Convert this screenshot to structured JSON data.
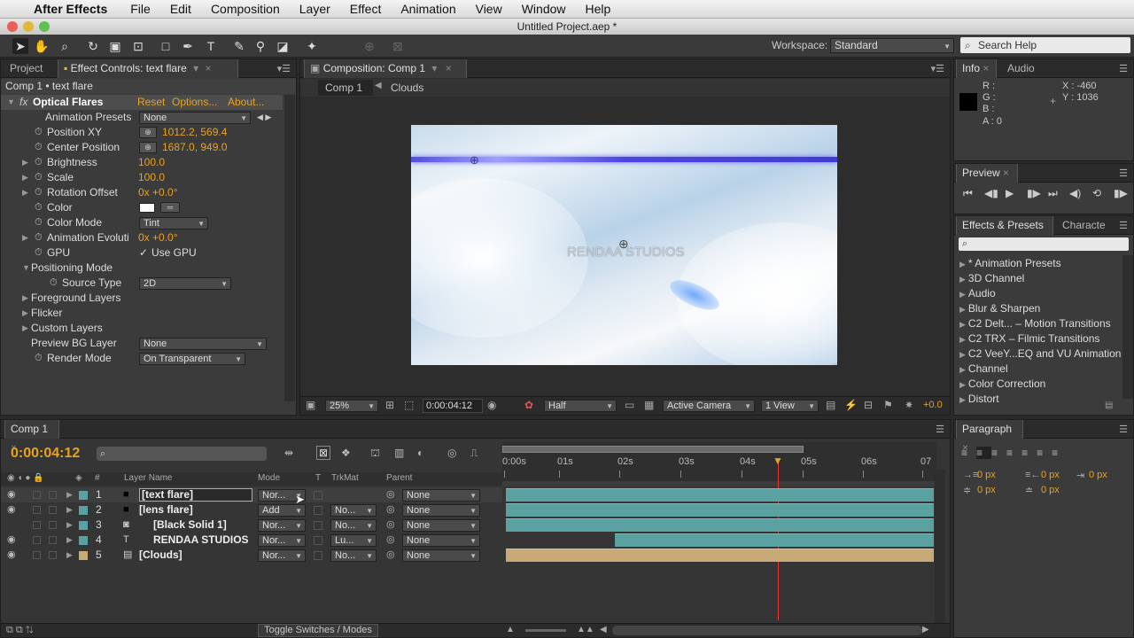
{
  "menubar": {
    "app": "After Effects",
    "items": [
      "File",
      "Edit",
      "Composition",
      "Layer",
      "Effect",
      "Animation",
      "View",
      "Window",
      "Help"
    ]
  },
  "window": {
    "title": "Untitled Project.aep *"
  },
  "toolbar": {
    "workspace_label": "Workspace:",
    "workspace_value": "Standard",
    "search_placeholder": "Search Help"
  },
  "left_panel": {
    "tab_project": "Project",
    "tab_effect": "Effect Controls: text flare",
    "breadcrumb": "Comp 1 • text flare",
    "fx_name": "Optical Flares",
    "reset": "Reset",
    "options": "Options...",
    "about": "About...",
    "rows": [
      {
        "label": "Animation Presets",
        "value": "None",
        "type": "dropdown"
      },
      {
        "label": "Position XY",
        "value": "1012.2, 569.4",
        "type": "point"
      },
      {
        "label": "Center Position",
        "value": "1687.0, 949.0",
        "type": "point"
      },
      {
        "label": "Brightness",
        "value": "100.0",
        "type": "num"
      },
      {
        "label": "Scale",
        "value": "100.0",
        "type": "num"
      },
      {
        "label": "Rotation Offset",
        "value": "0x +0.0°",
        "type": "num"
      },
      {
        "label": "Color",
        "value": "",
        "type": "color"
      },
      {
        "label": "Color Mode",
        "value": "Tint",
        "type": "dropdown"
      },
      {
        "label": "Animation Evoluti",
        "value": "0x +0.0°",
        "type": "num"
      },
      {
        "label": "GPU",
        "value": "Use GPU",
        "type": "check"
      },
      {
        "label": "Positioning Mode",
        "value": "",
        "type": "group"
      },
      {
        "label": "Source Type",
        "value": "2D",
        "type": "dropdown"
      },
      {
        "label": "Foreground Layers",
        "value": "",
        "type": "group"
      },
      {
        "label": "Flicker",
        "value": "",
        "type": "group"
      },
      {
        "label": "Custom Layers",
        "value": "",
        "type": "group"
      },
      {
        "label": "Preview BG Layer",
        "value": "None",
        "type": "dropdown"
      },
      {
        "label": "Render Mode",
        "value": "On Transparent",
        "type": "dropdown"
      }
    ]
  },
  "comp_panel": {
    "tab": "Composition: Comp 1",
    "crumb1": "Comp 1",
    "crumb2": "Clouds",
    "overlay_text": "RENDAA STUDIOS",
    "zoom": "25%",
    "timecode": "0:00:04:12",
    "resolution": "Half",
    "camera": "Active Camera",
    "views": "1 View",
    "exposure": "+0.0"
  },
  "info_panel": {
    "tab_info": "Info",
    "tab_audio": "Audio",
    "r": "R :",
    "g": "G :",
    "b": "B :",
    "a": "A : 0",
    "x": "X : -460",
    "y": "Y : 1036"
  },
  "preview_panel": {
    "tab": "Preview"
  },
  "effects_panel": {
    "tab": "Effects & Presets",
    "tab2": "Characte",
    "items": [
      "* Animation Presets",
      "3D Channel",
      "Audio",
      "Blur & Sharpen",
      "C2 Delt... – Motion Transitions",
      "C2 TRX – Filmic Transitions",
      "C2 VeeY...EQ and VU Animation",
      "Channel",
      "Color Correction",
      "Distort"
    ]
  },
  "paragraph_panel": {
    "tab": "Paragraph",
    "v1": "0 px",
    "v2": "0 px",
    "v3": "0 px",
    "v4": "0 px",
    "v5": "0 px"
  },
  "timeline": {
    "tab": "Comp 1",
    "timecode": "0:00:04:12",
    "col_layer": "Layer Name",
    "col_mode": "Mode",
    "col_t": "T",
    "col_trk": "TrkMat",
    "col_parent": "Parent",
    "ruler": [
      "0:00s",
      "01s",
      "02s",
      "03s",
      "04s",
      "05s",
      "06s",
      "07"
    ],
    "toggle": "Toggle Switches / Modes",
    "layers": [
      {
        "num": "1",
        "name": "[text flare]",
        "mode": "Nor...",
        "trk": "",
        "parent": "None",
        "color": "#5aa1a1"
      },
      {
        "num": "2",
        "name": "[lens flare]",
        "mode": "Add",
        "trk": "No...",
        "parent": "None",
        "color": "#5aa1a1"
      },
      {
        "num": "3",
        "name": "[Black Solid 1]",
        "mode": "Nor...",
        "trk": "No...",
        "parent": "None",
        "color": "#5aa1a1"
      },
      {
        "num": "4",
        "name": "RENDAA STUDIOS",
        "mode": "Nor...",
        "trk": "Lu...",
        "parent": "None",
        "color": "#5aa1a1"
      },
      {
        "num": "5",
        "name": "[Clouds]",
        "mode": "Nor...",
        "trk": "No...",
        "parent": "None",
        "color": "#c8a978"
      }
    ]
  }
}
